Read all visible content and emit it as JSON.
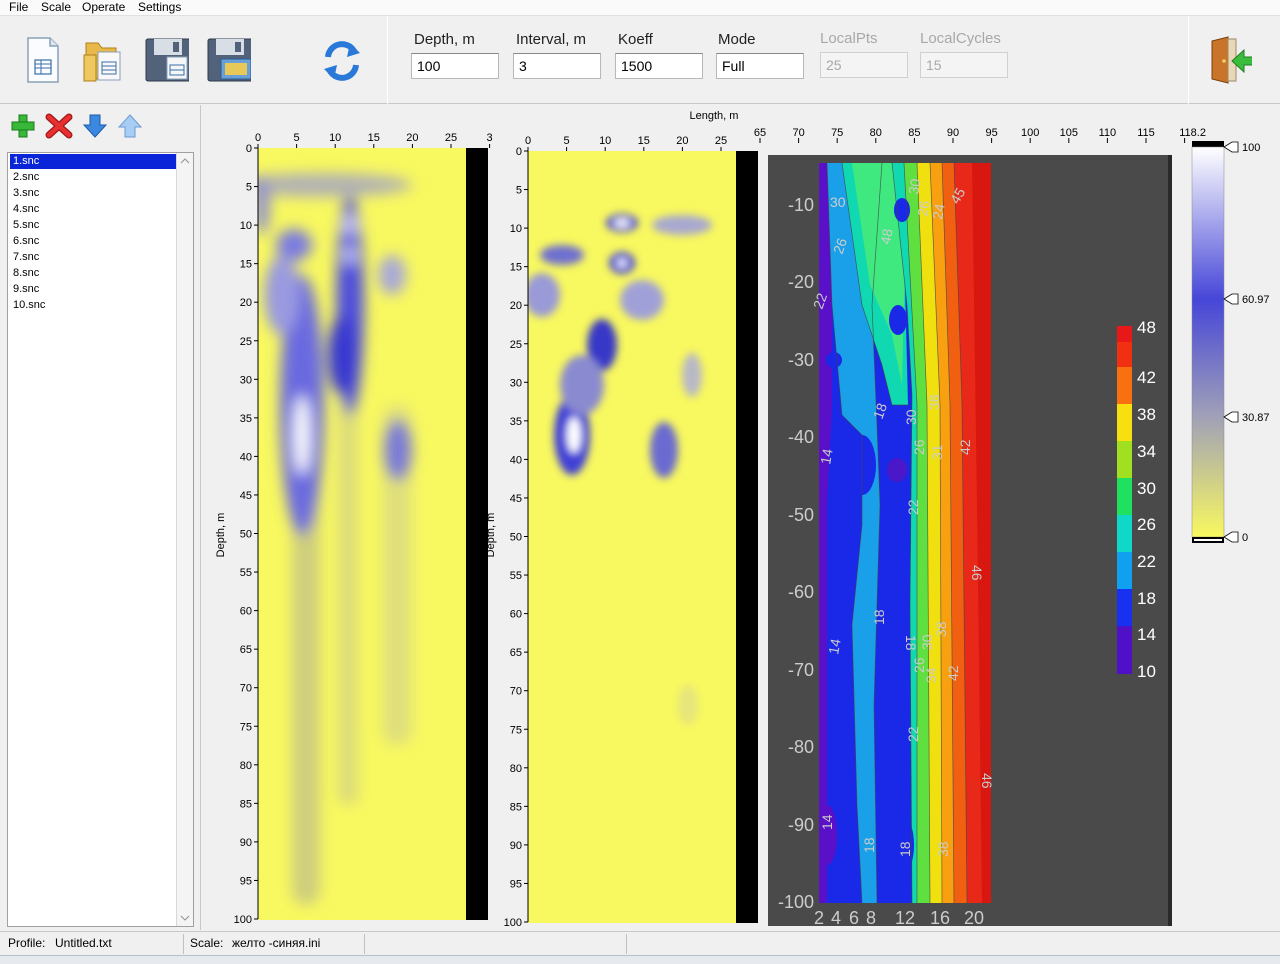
{
  "menu": [
    "File",
    "Scale",
    "Operate",
    "Settings"
  ],
  "toolbar": {
    "buttons": [
      "new-document-icon",
      "open-folder-icon",
      "save-icon",
      "save-as-icon",
      "refresh-icon",
      "exit-door-icon"
    ],
    "fields": [
      {
        "label": "Depth, m",
        "value": "100",
        "enabled": true
      },
      {
        "label": "Interval, m",
        "value": "3",
        "enabled": true
      },
      {
        "label": "Koeff",
        "value": "1500",
        "enabled": true
      },
      {
        "label": "Mode",
        "value": "Full",
        "enabled": true
      },
      {
        "label": "LocalPts",
        "value": "25",
        "enabled": false
      },
      {
        "label": "LocalCycles",
        "value": "15",
        "enabled": false
      }
    ]
  },
  "list_toolbar": [
    "add-icon",
    "delete-icon",
    "move-down-icon",
    "move-up-icon"
  ],
  "files": [
    "1.snc",
    "2.snc",
    "3.snc",
    "4.snc",
    "5.snc",
    "6.snc",
    "7.snc",
    "8.snc",
    "9.snc",
    "10.snc"
  ],
  "selected_file": "1.snc",
  "plots": {
    "length_label": "Length, m",
    "depth_label": "Depth, m",
    "panel1_x_ticks": [
      "0",
      "5",
      "10",
      "15",
      "20",
      "25",
      "3"
    ],
    "panel2_x_ticks": [
      "0",
      "5",
      "10",
      "15",
      "20",
      "25"
    ],
    "length_ticks": [
      "65",
      "70",
      "75",
      "80",
      "85",
      "90",
      "95",
      "100",
      "105",
      "110",
      "115",
      "118.2"
    ],
    "depth_ticks": [
      "0",
      "5",
      "10",
      "15",
      "20",
      "25",
      "30",
      "35",
      "40",
      "45",
      "50",
      "55",
      "60",
      "65",
      "70",
      "75",
      "80",
      "85",
      "90",
      "95",
      "100"
    ],
    "contour_y_ticks": [
      "-10",
      "-20",
      "-30",
      "-40",
      "-50",
      "-60",
      "-70",
      "-80",
      "-90",
      "-100"
    ],
    "contour_x_ticks": [
      "2",
      "4",
      "6",
      "8",
      "12",
      "16",
      "20"
    ],
    "contour_colorbar": [
      "48",
      "42",
      "38",
      "34",
      "30",
      "26",
      "22",
      "18",
      "14",
      "10"
    ],
    "contour_labels": [
      "30",
      "26",
      "22",
      "48",
      "30",
      "26",
      "24",
      "45",
      "14",
      "18",
      "38",
      "30",
      "26",
      "31",
      "42",
      "22",
      "46",
      "18",
      "18",
      "30",
      "38",
      "14",
      "26",
      "34",
      "42",
      "22",
      "46",
      "14",
      "18",
      "18",
      "38"
    ],
    "gradient_bar_ticks": [
      "100",
      "60.97",
      "30.87",
      "0"
    ],
    "colors": {
      "yellow": "#f8f860",
      "blue": "#3c3cdc",
      "white": "#ffffff",
      "contour_bg": "#4a4a4a",
      "selection": "#0a24d8"
    }
  },
  "status": {
    "profile_label": "Profile:",
    "profile_value": "Untitled.txt",
    "scale_label": "Scale:",
    "scale_value": "желто -синяя.ini"
  }
}
